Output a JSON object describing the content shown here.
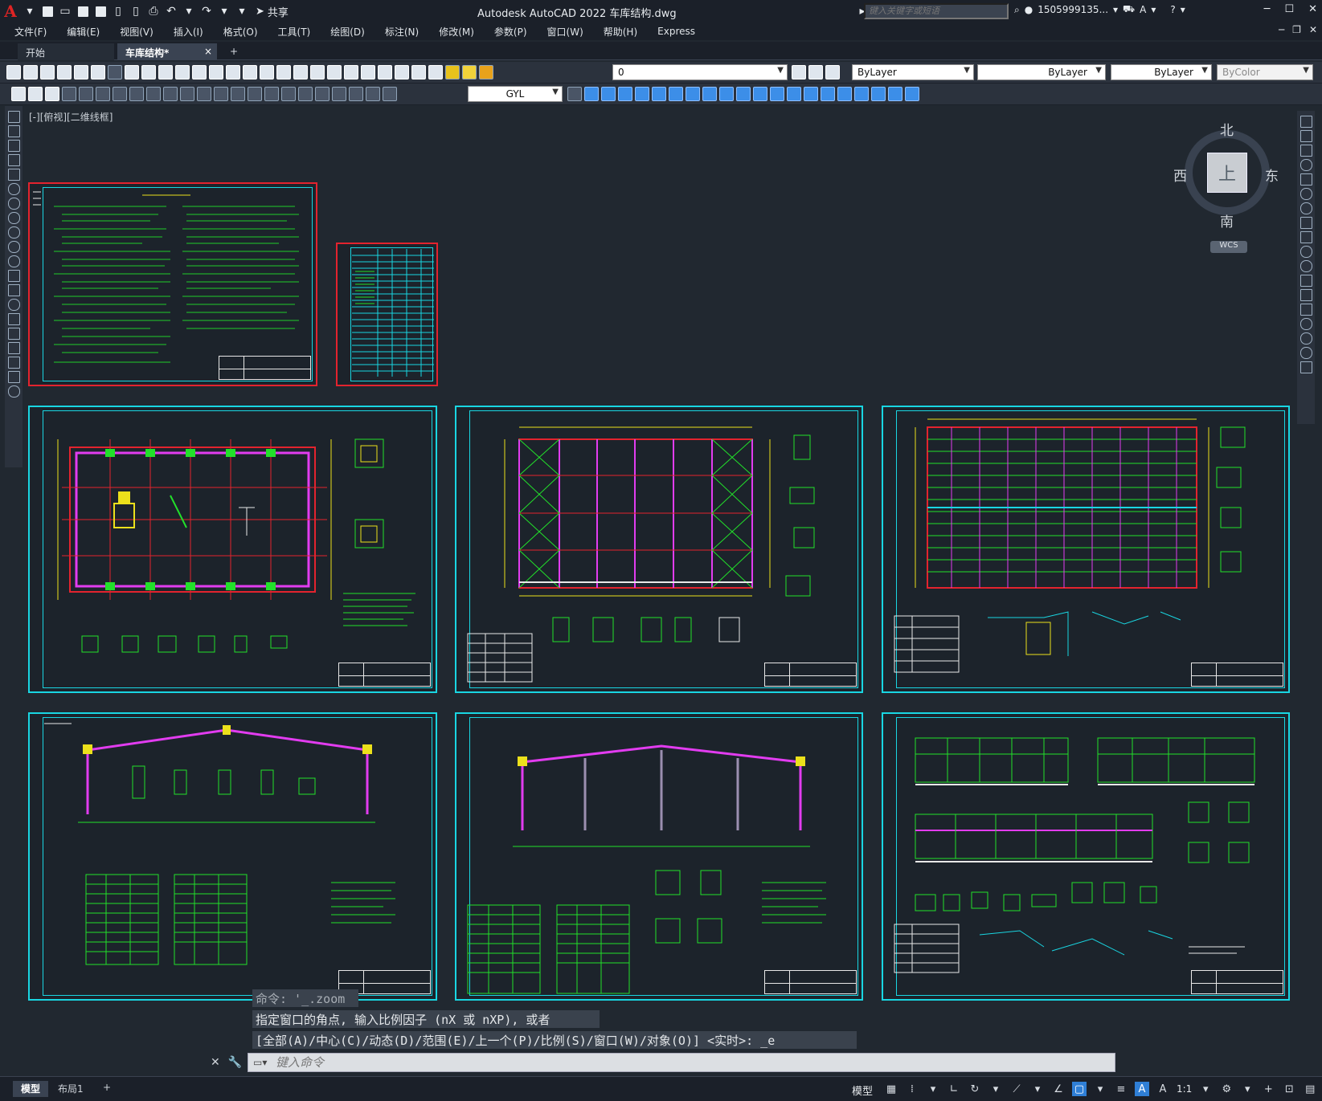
{
  "titlebar": {
    "app_logo": "A",
    "title": "Autodesk AutoCAD 2022    车库结构.dwg",
    "share_label": "共享",
    "search_placeholder": "键入关键字或短语",
    "user": "1505999135...",
    "icons": [
      "new-icon",
      "open-icon",
      "save-icon",
      "saveas-icon",
      "plot-icon",
      "undo-icon",
      "redo-icon",
      "share-icon",
      "search-icon",
      "user-icon",
      "cart-icon",
      "help-icon"
    ]
  },
  "menubar": {
    "items": [
      "文件(F)",
      "编辑(E)",
      "视图(V)",
      "插入(I)",
      "格式(O)",
      "工具(T)",
      "绘图(D)",
      "标注(N)",
      "修改(M)",
      "参数(P)",
      "窗口(W)",
      "帮助(H)",
      "Express"
    ]
  },
  "tabs": {
    "start": "开始",
    "file": "车库结构*",
    "close": "×",
    "add": "+"
  },
  "toolbar": {
    "layer_value": "0",
    "color_value": "ByLayer",
    "linetype_value": "ByLayer",
    "lineweight_value": "ByLayer",
    "plotstyle_value": "ByColor",
    "textstyle_value": "GYL"
  },
  "viewport": {
    "label": "[-][俯视][二维线框]"
  },
  "viewcube": {
    "north": "北",
    "south": "南",
    "west": "西",
    "east": "东",
    "top": "上",
    "wcs": "WCS"
  },
  "command": {
    "history": [
      "命令: '_.zoom",
      "指定窗口的角点, 输入比例因子 (nX 或 nXP), 或者",
      "[全部(A)/中心(C)/动态(D)/范围(E)/上一个(P)/比例(S)/窗口(W)/对象(O)] <实时>: _e"
    ],
    "placeholder": "键入命令"
  },
  "statusbar": {
    "layout_tabs": [
      "模型",
      "布局1"
    ],
    "add_tab": "+",
    "model_label": "模型",
    "scale": "1:1"
  },
  "colors": {
    "background": "#212830",
    "sheet_border": "#19d6e2",
    "selected_border": "#e3232e",
    "drawing_green": "#22e02a",
    "drawing_red": "#e3232e",
    "drawing_magenta": "#e23cf0",
    "drawing_yellow": "#ece01b"
  }
}
